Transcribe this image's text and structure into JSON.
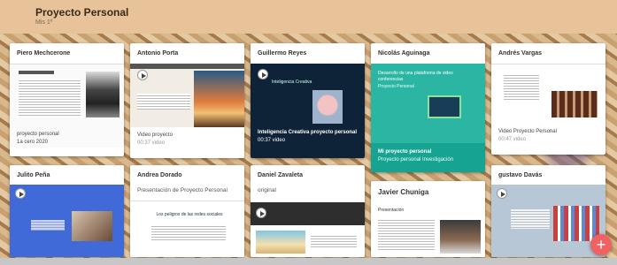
{
  "board": {
    "title": "Proyecto Personal",
    "subtitle": "Mis 1º"
  },
  "cards": [
    {
      "author": "Piero Mechcerone",
      "caption_1": "proyecto personal",
      "caption_2": "1a cero 2020"
    },
    {
      "author": "Antonio Porta",
      "caption_1": "Video proyecto",
      "caption_2": "00:37 video"
    },
    {
      "author": "Guillermo Reyes",
      "slide_title": "Inteligencia Creativa",
      "caption_1": "Inteligencia Creativa proyecto personal",
      "caption_2": "00:37 video"
    },
    {
      "author": "Nicolás Aguinaga",
      "slide_title": "Desarrollo de una plataforma de video conferencias",
      "slide_sub": "Proyecto Personal",
      "caption_1": "Mi proyecto personal",
      "caption_2": "Proyecto personal Investigación"
    },
    {
      "author": "Andrés Vargas",
      "caption_1": "Video Proyecto Personal",
      "caption_2": "00:47 video"
    },
    {
      "author": "Julito Peña",
      "caption_1": "",
      "caption_2": ""
    },
    {
      "author": "Andrea Dorado",
      "caption_1": "Presentación de Proyecto Personal",
      "slide_title": "Los peligros de las redes sociales",
      "caption_2": ""
    },
    {
      "author": "Daniel Zavaleta",
      "caption_1": "original",
      "caption_2": ""
    },
    {
      "author": "Javier Chuniga",
      "caption_1": "Presentación",
      "caption_2": ""
    },
    {
      "author": "gustavo Davás",
      "caption_1": "",
      "caption_2": ""
    }
  ],
  "fab": {
    "label": "+"
  },
  "colors": {
    "header": "#e8c39a",
    "fab": "#f06262",
    "teal": "#2bb6a3",
    "navy": "#0e2238"
  }
}
